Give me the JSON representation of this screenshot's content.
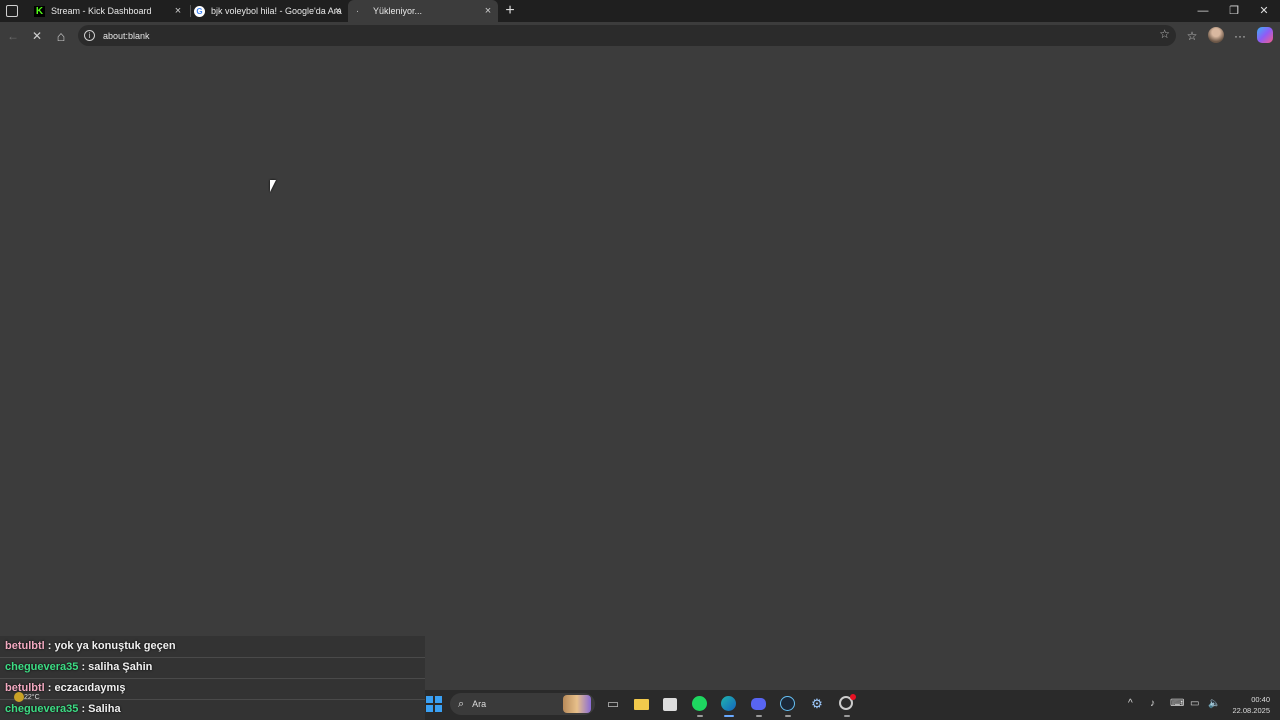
{
  "tabs": [
    {
      "label": "Stream - Kick Dashboard",
      "favicon": "kick-logo-icon",
      "close": "×"
    },
    {
      "label": "bjk voleybol hila! - Google'da Ara",
      "favicon": "google-logo-icon",
      "close": "×"
    },
    {
      "label": "Yükleniyor...",
      "favicon": "loading-icon",
      "close": "×",
      "active": true
    }
  ],
  "new_tab": "+",
  "window_controls": {
    "minimize": "—",
    "restore": "❐",
    "close": "✕"
  },
  "toolbar": {
    "back": "←",
    "stop": "✕",
    "home": "⌂",
    "favorites": "☆",
    "menu": "···"
  },
  "address_bar": {
    "url": "about:blank",
    "info": "i",
    "star": "☆"
  },
  "chat": [
    {
      "user": "betulbtl",
      "sep": " : ",
      "message": "yok ya konuştuk geçen",
      "color": "#f2a9c0"
    },
    {
      "user": "cheguevera35",
      "sep": " : ",
      "message": "saliha Şahin",
      "color": "#3ddc84"
    },
    {
      "user": "betulbtl",
      "sep": " : ",
      "message": "eczacıdaymış",
      "color": "#f2a9c0"
    },
    {
      "user": "cheguevera35",
      "sep": " : ",
      "message": "Saliha",
      "color": "#3ddc84"
    }
  ],
  "taskbar": {
    "weather": "22°C",
    "search_placeholder": "Ara",
    "apps": [
      {
        "name": "task-view-icon",
        "glyph": "▭"
      },
      {
        "name": "file-explorer-icon",
        "glyph": "📁"
      },
      {
        "name": "store-icon",
        "glyph": "🛍"
      },
      {
        "name": "spotify-icon",
        "glyph": "●"
      },
      {
        "name": "edge-icon",
        "glyph": "◉"
      },
      {
        "name": "discord-icon",
        "glyph": "◕"
      },
      {
        "name": "steam-icon",
        "glyph": "◈"
      },
      {
        "name": "settings-icon",
        "glyph": "⚙"
      },
      {
        "name": "app-icon",
        "glyph": "◌"
      }
    ],
    "tray": {
      "chevron": "^",
      "time": "00:40",
      "date": "22.08.2025"
    }
  }
}
